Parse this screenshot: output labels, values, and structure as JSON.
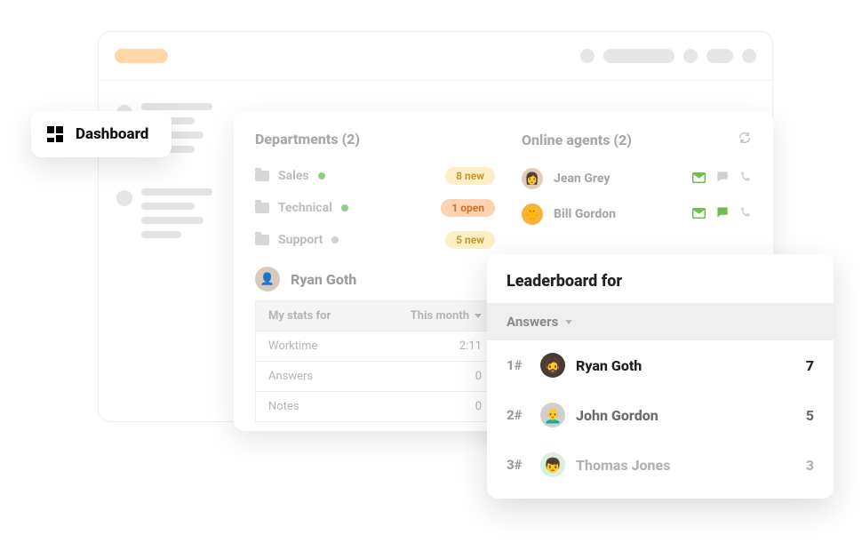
{
  "dashboard_label": "Dashboard",
  "departments": {
    "title": "Departments (2)",
    "items": [
      {
        "name": "Sales",
        "status": "online",
        "badge_text": "8 new",
        "badge_type": "new"
      },
      {
        "name": "Technical",
        "status": "online",
        "badge_text": "1 open",
        "badge_type": "open"
      },
      {
        "name": "Support",
        "status": "offline",
        "badge_text": "5 new",
        "badge_type": "new"
      }
    ]
  },
  "online_agents": {
    "title": "Online agents (2)",
    "items": [
      {
        "name": "Jean Grey",
        "chat_active": false
      },
      {
        "name": "Bill Gordon",
        "chat_active": true
      }
    ]
  },
  "mystats": {
    "agent_name": "Ryan Goth",
    "filter_label": "My stats for",
    "period": "This month",
    "rows": [
      {
        "label": "Worktime",
        "value": "2:11"
      },
      {
        "label": "Answers",
        "value": "0"
      },
      {
        "label": "Notes",
        "value": "0"
      }
    ]
  },
  "leaderboard": {
    "title": "Leaderboard for",
    "filter": "Answers",
    "rows": [
      {
        "rank": "1#",
        "name": "Ryan Goth",
        "score": "7"
      },
      {
        "rank": "2#",
        "name": "John Gordon",
        "score": "5"
      },
      {
        "rank": "3#",
        "name": "Thomas Jones",
        "score": "3"
      }
    ]
  }
}
